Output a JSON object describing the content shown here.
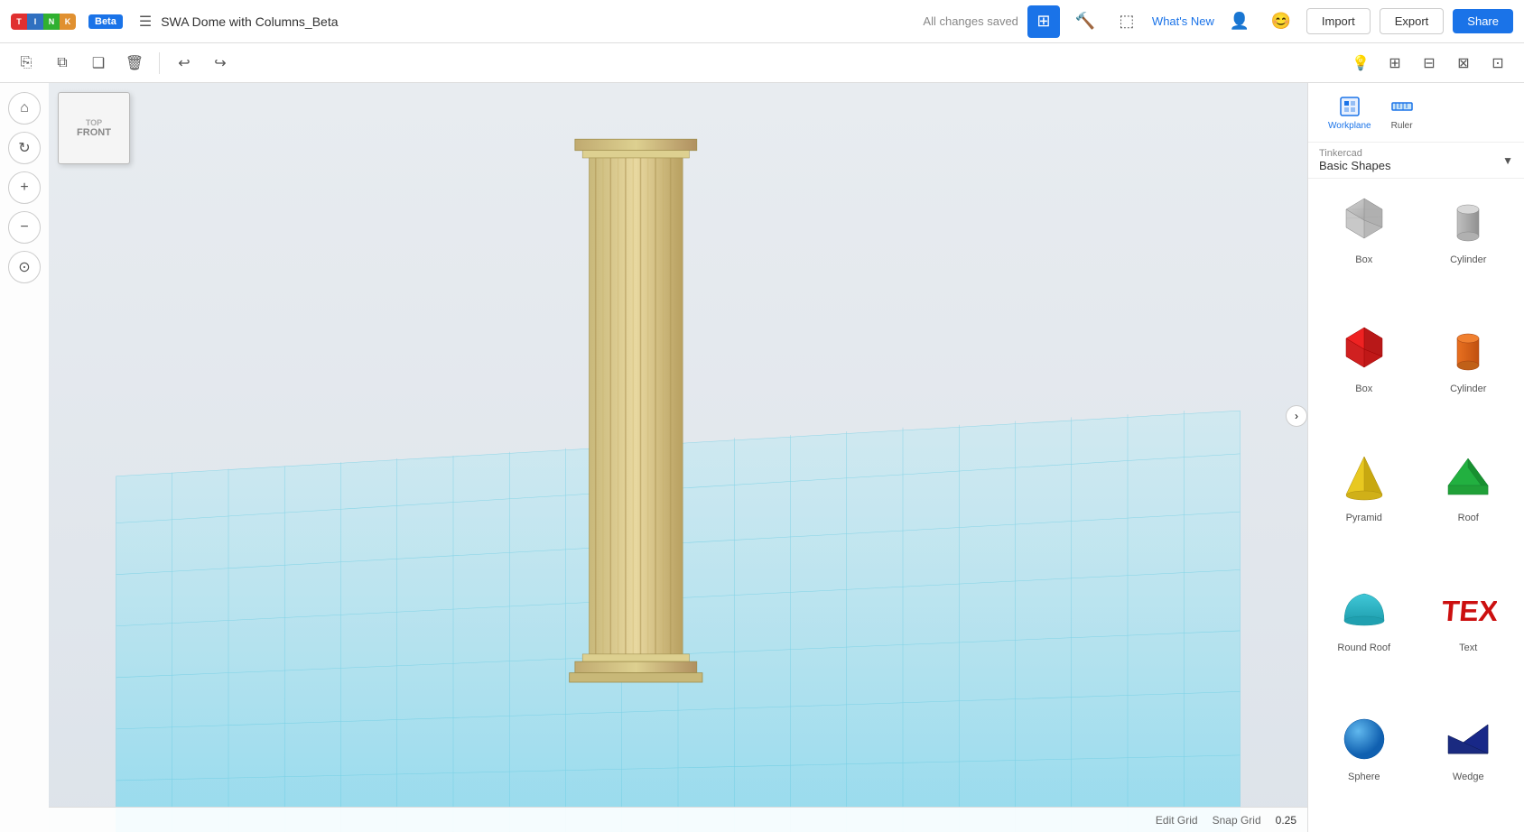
{
  "topbar": {
    "beta_label": "Beta",
    "title": "SWA Dome with Columns_Beta",
    "saved_status": "All changes saved",
    "whats_new": "What's New",
    "import_label": "Import",
    "export_label": "Export",
    "share_label": "Share"
  },
  "toolbar": {
    "tools": [
      {
        "name": "paste",
        "icon": "⎘"
      },
      {
        "name": "copy",
        "icon": "⧉"
      },
      {
        "name": "duplicate",
        "icon": "❑"
      },
      {
        "name": "delete",
        "icon": "🗑"
      },
      {
        "name": "undo",
        "icon": "↩"
      },
      {
        "name": "redo",
        "icon": "↪"
      }
    ],
    "right_tools": [
      {
        "name": "light",
        "icon": "💡"
      },
      {
        "name": "align",
        "icon": "⊞"
      },
      {
        "name": "mirror",
        "icon": "⊟"
      },
      {
        "name": "align2",
        "icon": "⊠"
      },
      {
        "name": "flip",
        "icon": "⊡"
      }
    ]
  },
  "left_panel": {
    "buttons": [
      {
        "name": "home",
        "icon": "⌂"
      },
      {
        "name": "rotate",
        "icon": "↻"
      },
      {
        "name": "zoom-in",
        "icon": "+"
      },
      {
        "name": "zoom-out",
        "icon": "−"
      },
      {
        "name": "fit",
        "icon": "⊙"
      }
    ]
  },
  "viewport": {
    "view_cube_label": "FRONT"
  },
  "bottom_bar": {
    "edit_grid_label": "Edit Grid",
    "snap_grid_label": "Snap Grid",
    "snap_grid_value": "0.25"
  },
  "right_panel": {
    "workplane_label": "Workplane",
    "ruler_label": "Ruler",
    "tinkercad_label": "Tinkercad",
    "category_label": "Basic Shapes",
    "shapes": [
      {
        "name": "Box",
        "color": "#b0b0b0",
        "type": "box-gray"
      },
      {
        "name": "Cylinder",
        "color": "#b0b0b0",
        "type": "cylinder-gray"
      },
      {
        "name": "Box",
        "color": "#cc2222",
        "type": "box-red"
      },
      {
        "name": "Cylinder",
        "color": "#e07020",
        "type": "cylinder-orange"
      },
      {
        "name": "Pyramid",
        "color": "#e8d020",
        "type": "pyramid-yellow"
      },
      {
        "name": "Roof",
        "color": "#22a040",
        "type": "roof-green"
      },
      {
        "name": "Round Roof",
        "color": "#30b0c0",
        "type": "round-roof-teal"
      },
      {
        "name": "Text",
        "color": "#cc2222",
        "type": "text-red"
      },
      {
        "name": "Sphere",
        "color": "#1a80cc",
        "type": "sphere-blue"
      },
      {
        "name": "Wedge",
        "color": "#1a3088",
        "type": "wedge-blue"
      }
    ]
  }
}
